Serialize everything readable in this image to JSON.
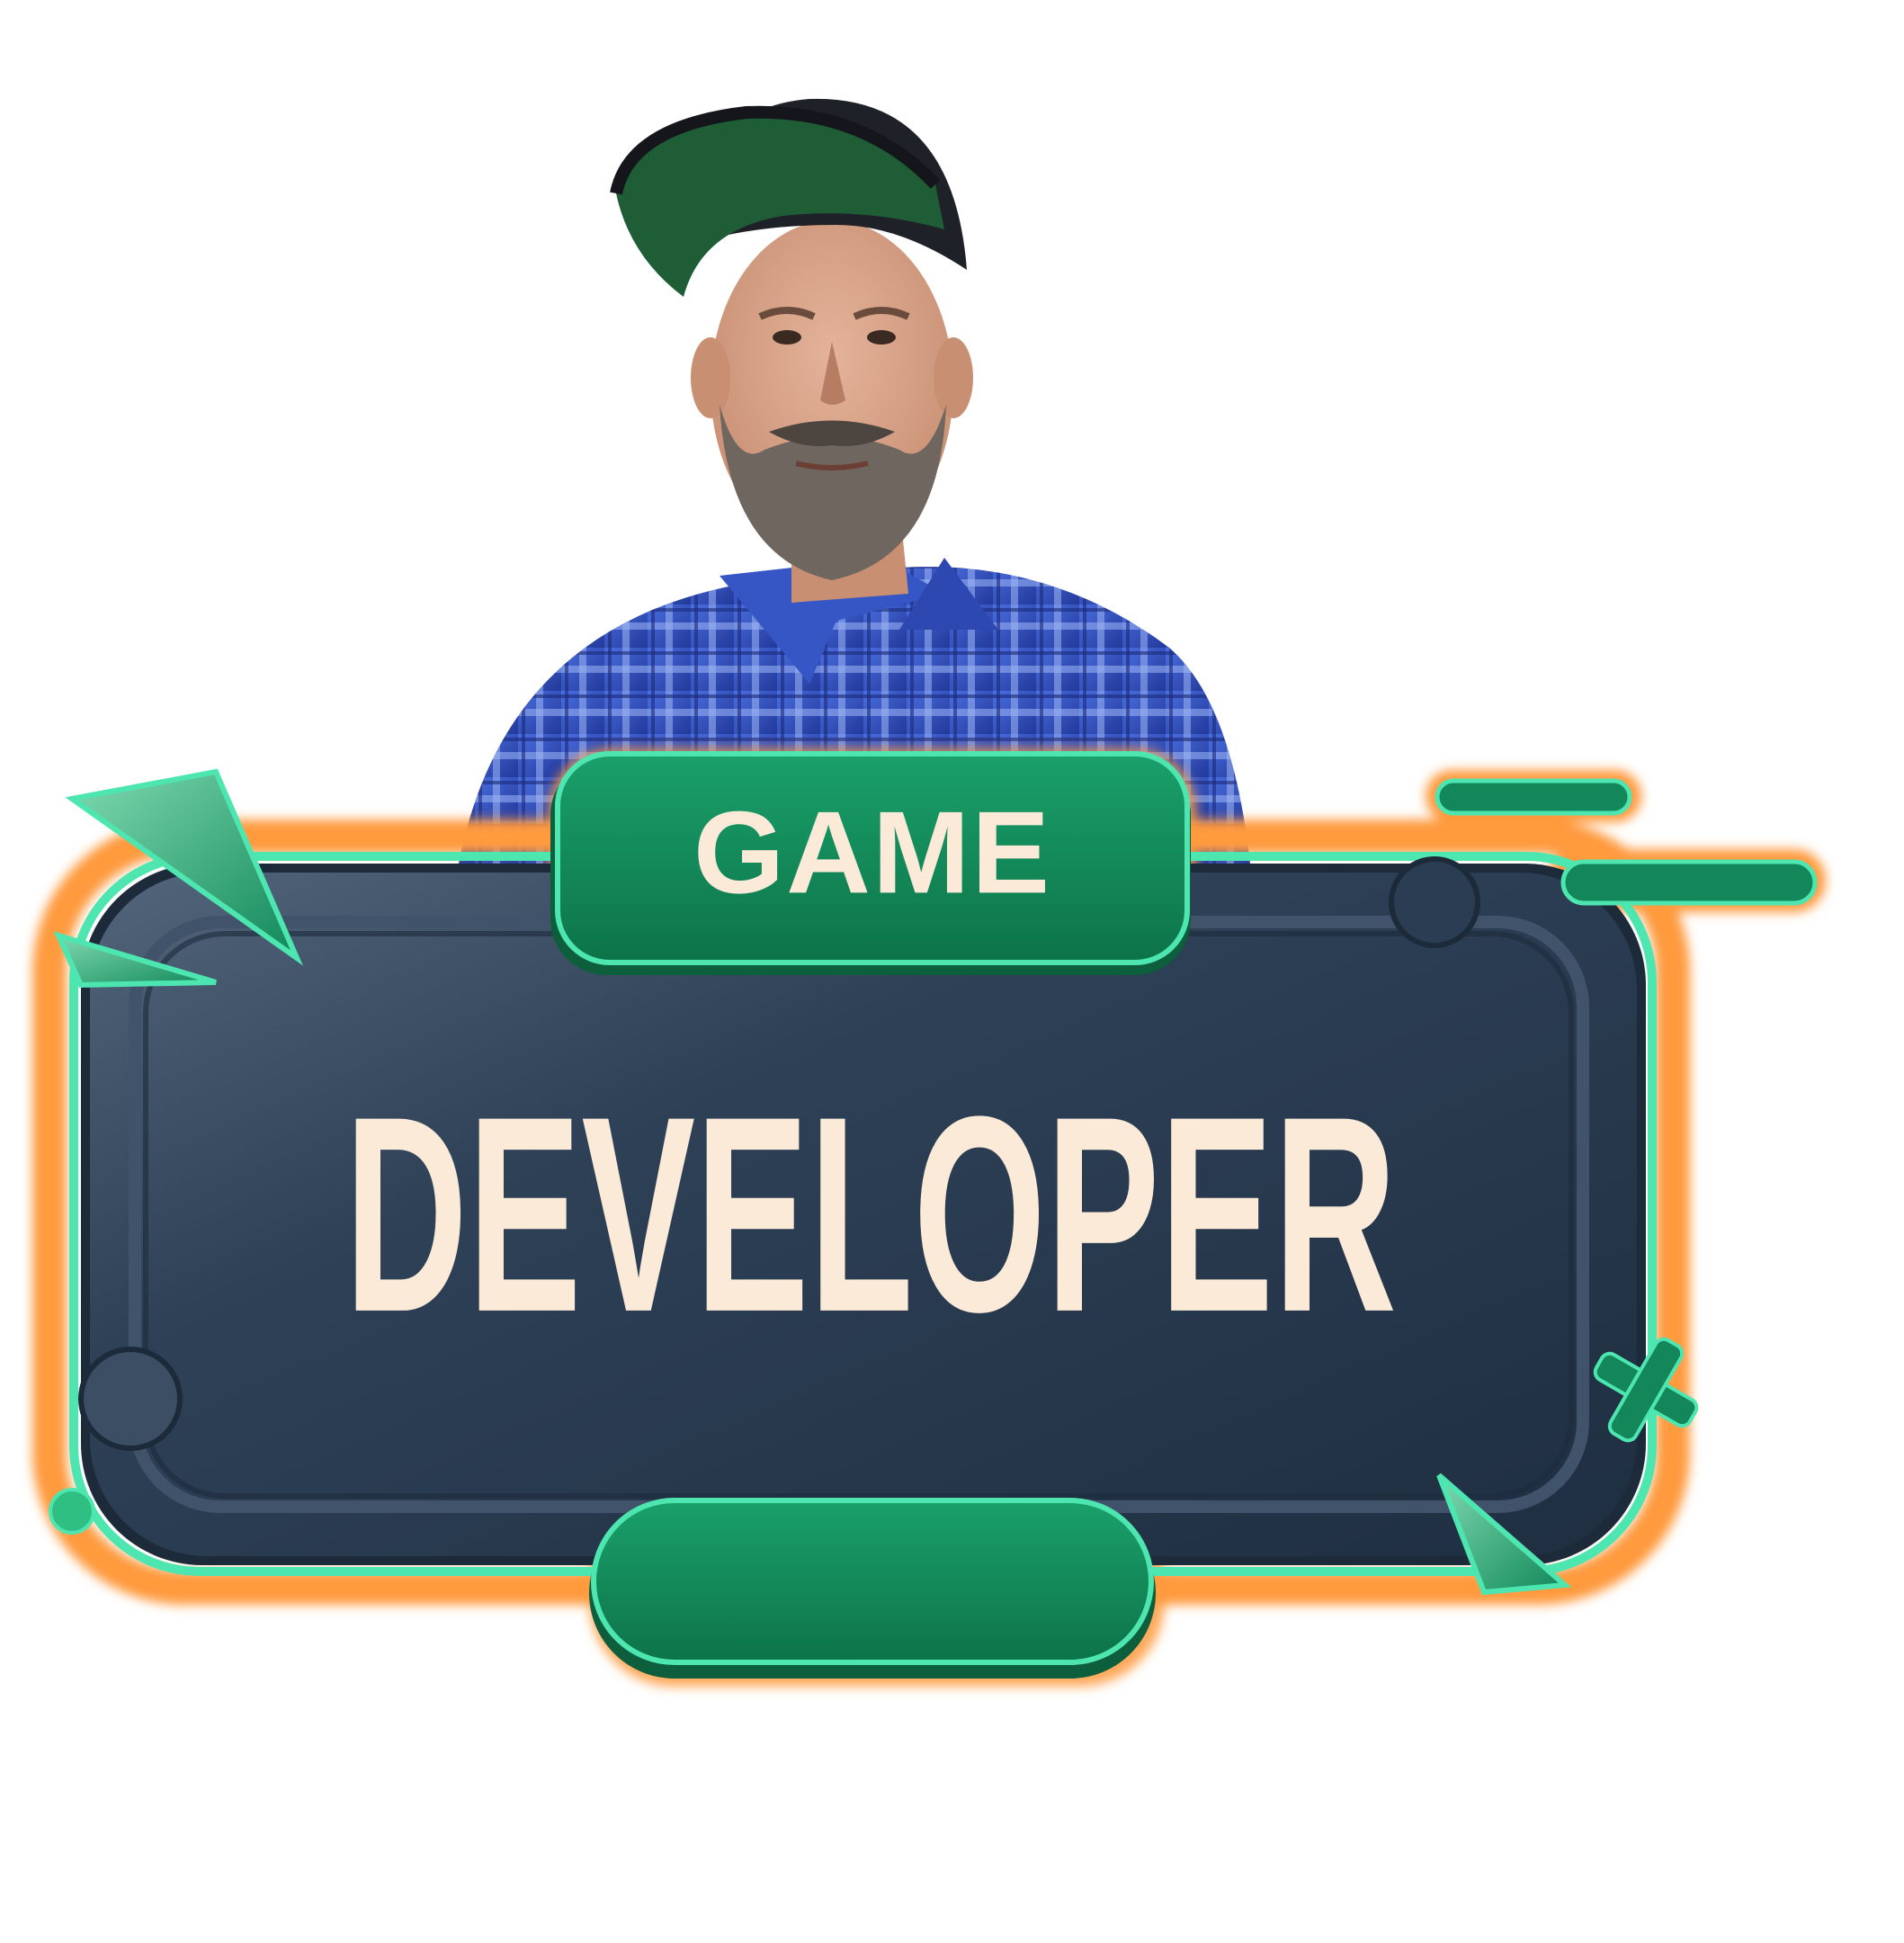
{
  "badge": {
    "top_label": "GAME",
    "main_label": "DEVELOPER",
    "bottom_label": ""
  },
  "colors": {
    "background": "#ffffff",
    "panel": "#2b3d52",
    "panel_dark": "#1c2a3a",
    "accent_green": "#13875a",
    "accent_green_light": "#2fbf82",
    "glow_orange": "#ff9a3c",
    "outline_mint": "#4ee6b0",
    "text_cream": "#fbead8"
  },
  "icons": [
    "triangle-shape-icon",
    "x-cross-icon",
    "dash-bar-icon",
    "circle-dot-icon"
  ]
}
